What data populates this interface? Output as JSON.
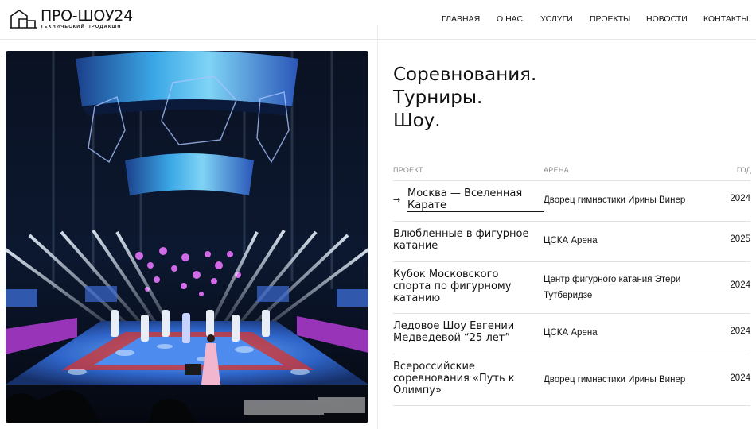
{
  "logo": {
    "title": "ПРО-ШОУ24",
    "subtitle": "ТЕХНИЧЕСКИЙ ПРОДАКШН",
    "icon": "building-outline-icon"
  },
  "nav": {
    "items": [
      {
        "label": "ГЛАВНАЯ"
      },
      {
        "label": "О НАС"
      },
      {
        "label": "УСЛУГИ"
      },
      {
        "label": "ПРОЕКТЫ",
        "active": true
      },
      {
        "label": "НОВОСТИ"
      },
      {
        "label": "КОНТАКТЫ"
      }
    ]
  },
  "hero": {
    "lines": [
      "Соревнования.",
      "Турниры.",
      "Шоу."
    ]
  },
  "table": {
    "headers": {
      "project": "ПРОЕКТ",
      "arena": "АРЕНА",
      "year": "ГОД"
    },
    "rows": [
      {
        "project": "Москва — Вселенная Карате",
        "arena": "Дворец гимнастики Ирины Винер",
        "year": "2024",
        "hovered": true
      },
      {
        "project": "Влюбленные в фигурное катание",
        "arena": "ЦСКА Арена",
        "year": "2025"
      },
      {
        "project": "Кубок Московского спорта по фигурному катанию",
        "arena": "Центр фигурного катания Этери Тутберидзе",
        "year": "2024"
      },
      {
        "project": "Ледовое Шоу Евгении Медведевой “25 лет”",
        "arena": "ЦСКА Арена",
        "year": "2024"
      },
      {
        "project": "Всероссийские соревнования «Путь к Олимпу»",
        "arena": "Дворец гимнастики Ирины Винер",
        "year": "2024"
      }
    ],
    "arrow_icon": "arrow-right-icon"
  },
  "colors": {
    "text": "#141414",
    "muted": "#8a8a8a",
    "divider": "#e2e2e2"
  }
}
